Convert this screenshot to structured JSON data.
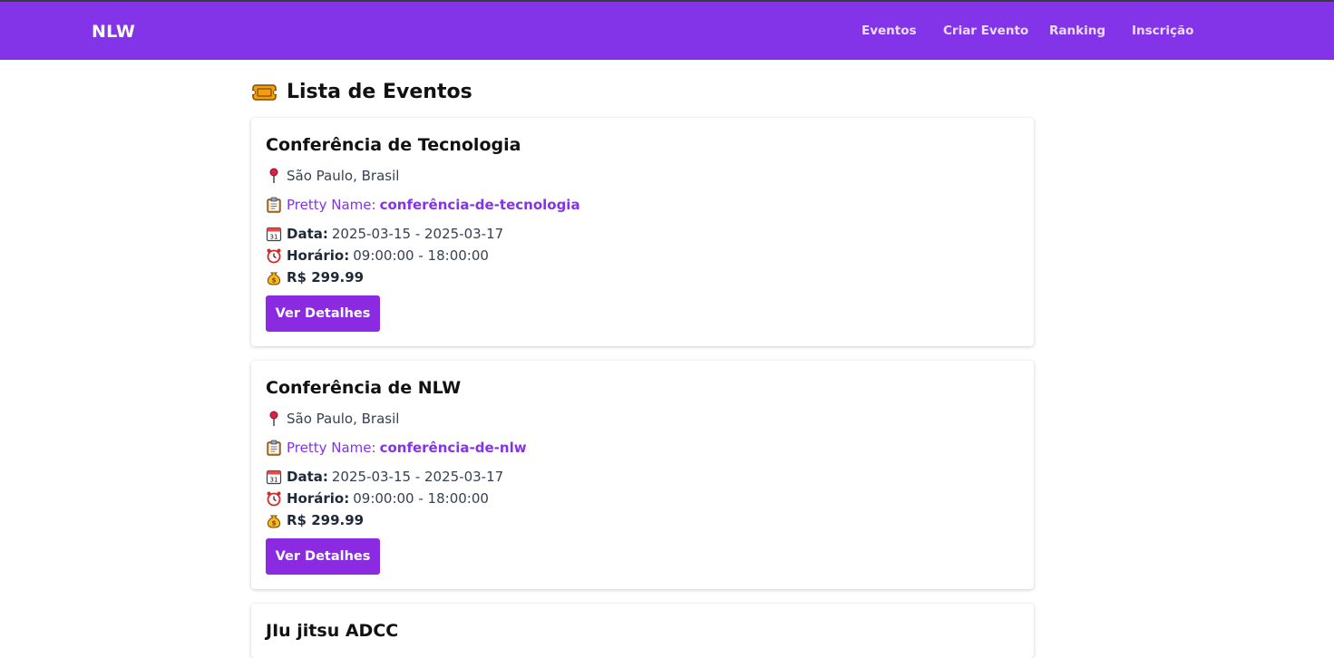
{
  "header": {
    "brand": "NLW",
    "nav": [
      {
        "label": "Eventos"
      },
      {
        "label": "Criar Evento"
      },
      {
        "label": "Ranking"
      },
      {
        "label": "Inscrição"
      }
    ]
  },
  "page": {
    "title": "Lista de Eventos",
    "title_icon": "ticket-icon"
  },
  "events": [
    {
      "title": "Conferência de Tecnologia",
      "location": "São Paulo, Brasil",
      "pretty_label": "Pretty Name:",
      "pretty_name": "conferência-de-tecnologia",
      "date_label": "Data:",
      "date": "2025-03-15 - 2025-03-17",
      "time_label": "Horário:",
      "time": "09:00:00 - 18:00:00",
      "price": "R$ 299.99",
      "button": "Ver Detalhes"
    },
    {
      "title": "Conferência de NLW",
      "location": "São Paulo, Brasil",
      "pretty_label": "Pretty Name:",
      "pretty_name": "conferência-de-nlw",
      "date_label": "Data:",
      "date": "2025-03-15 - 2025-03-17",
      "time_label": "Horário:",
      "time": "09:00:00 - 18:00:00",
      "price": "R$ 299.99",
      "button": "Ver Detalhes"
    },
    {
      "title": "JIu jitsu ADCC"
    }
  ],
  "colors": {
    "navbar": "#8334e8",
    "accent": "#8334e8",
    "button": "#8a2be2"
  }
}
